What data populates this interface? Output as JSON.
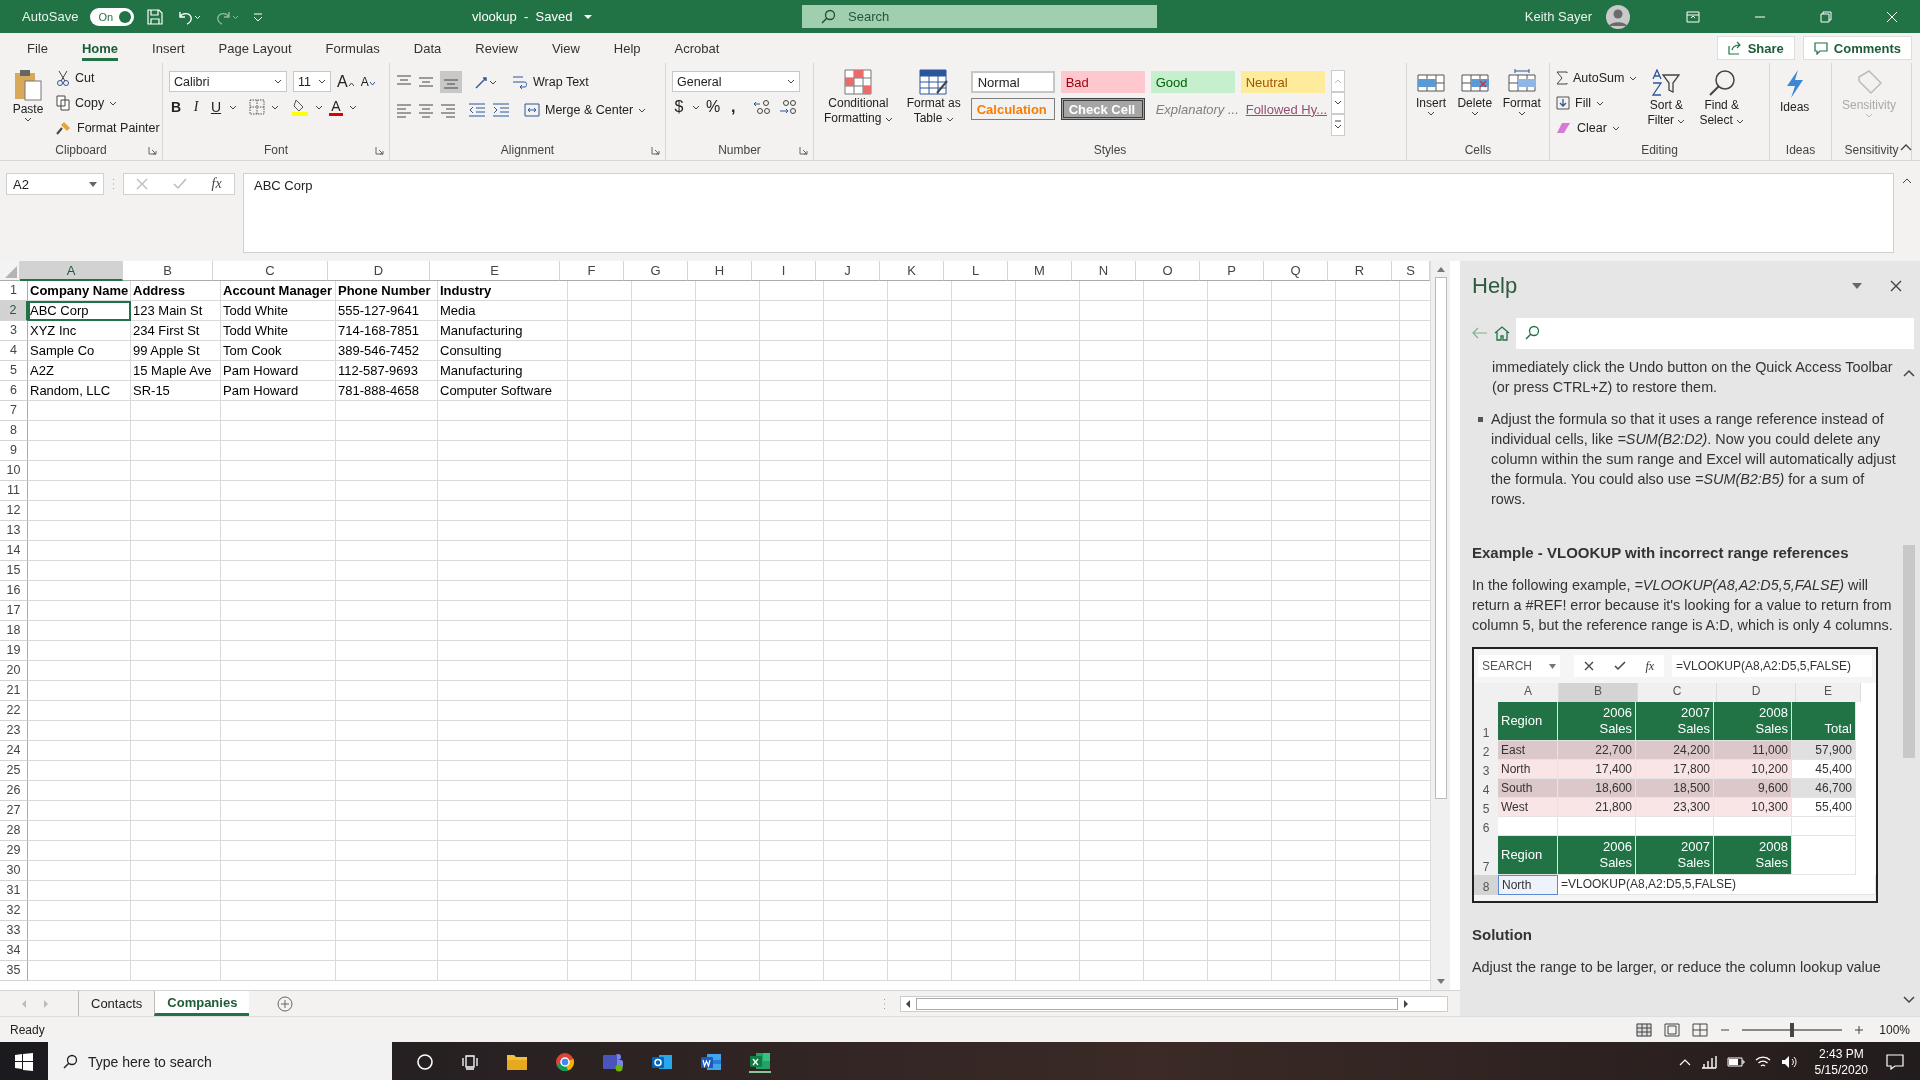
{
  "title_bar": {
    "autosave_label": "AutoSave",
    "autosave": {
      "on": true,
      "label": "On"
    },
    "title": "vlookup  -  Saved",
    "search_placeholder": "Search",
    "user": "Keith Sayer"
  },
  "ribbon_tabs": [
    {
      "label": "File",
      "selected": false
    },
    {
      "label": "Home",
      "selected": true
    },
    {
      "label": "Insert",
      "selected": false
    },
    {
      "label": "Page Layout",
      "selected": false
    },
    {
      "label": "Formulas",
      "selected": false
    },
    {
      "label": "Data",
      "selected": false
    },
    {
      "label": "Review",
      "selected": false
    },
    {
      "label": "View",
      "selected": false
    },
    {
      "label": "Help",
      "selected": false
    },
    {
      "label": "Acrobat",
      "selected": false
    }
  ],
  "share": "Share",
  "comments": "Comments",
  "clipboard": {
    "paste": "Paste",
    "cut": "Cut",
    "copy": "Copy",
    "format_painter": "Format Painter",
    "label": "Clipboard"
  },
  "font": {
    "name": "Calibri",
    "size": "11",
    "grow": "A",
    "shrink": "A",
    "bold": "B",
    "italic": "I",
    "underline": "U",
    "font_color_button": "A",
    "label": "Font"
  },
  "alignment": {
    "wrap_text": "Wrap Text",
    "merge_center": "Merge & Center",
    "label": "Alignment"
  },
  "number": {
    "format": "General",
    "currency": "$",
    "percent": "%",
    "comma": ",",
    "label": "Number"
  },
  "styles": {
    "conditional_formatting": [
      "Conditional",
      "Formatting"
    ],
    "format_as_table": [
      "Format as",
      "Table"
    ],
    "items": [
      {
        "label": "Normal",
        "kind": "normal"
      },
      {
        "label": "Bad",
        "kind": "bad"
      },
      {
        "label": "Good",
        "kind": "good"
      },
      {
        "label": "Neutral",
        "kind": "neutral"
      },
      {
        "label": "Calculation",
        "kind": "calculation"
      },
      {
        "label": "Check Cell",
        "kind": "check"
      },
      {
        "label": "Explanatory ...",
        "kind": "explanatory"
      },
      {
        "label": "Followed Hy...",
        "kind": "hyperlink"
      }
    ],
    "label": "Styles"
  },
  "cells": {
    "buttons": [
      "Insert",
      "Delete",
      "Format"
    ],
    "label": "Cells"
  },
  "editing": {
    "autosum": "AutoSum",
    "fill": "Fill",
    "clear": "Clear",
    "sort_filter": [
      "Sort &",
      "Filter"
    ],
    "find_select": [
      "Find &",
      "Select"
    ],
    "label": "Editing"
  },
  "ideas": {
    "button": "Ideas",
    "label": "Ideas"
  },
  "sensitivity": {
    "button": "Sensitivity",
    "disabled": true,
    "label": "Sensitivity"
  },
  "formula_bar": {
    "name_box": "A2",
    "fx": "fx",
    "formula": "ABC Corp"
  },
  "sheet": {
    "columns": [
      {
        "label": "A",
        "selected": true
      },
      {
        "label": "B",
        "selected": false
      },
      {
        "label": "C",
        "selected": false
      },
      {
        "label": "D",
        "selected": false
      },
      {
        "label": "E",
        "selected": false
      },
      {
        "label": "F",
        "selected": false
      },
      {
        "label": "G",
        "selected": false
      },
      {
        "label": "H",
        "selected": false
      },
      {
        "label": "I",
        "selected": false
      },
      {
        "label": "J",
        "selected": false
      },
      {
        "label": "K",
        "selected": false
      },
      {
        "label": "L",
        "selected": false
      },
      {
        "label": "M",
        "selected": false
      },
      {
        "label": "N",
        "selected": false
      },
      {
        "label": "O",
        "selected": false
      },
      {
        "label": "P",
        "selected": false
      },
      {
        "label": "Q",
        "selected": false
      },
      {
        "label": "R",
        "selected": false
      },
      {
        "label": "S",
        "selected": false
      }
    ],
    "rows": [
      {
        "number": "1",
        "selected": false,
        "bold": true,
        "cells": [
          "Company Name",
          "Address",
          "Account Manager",
          "Phone Number",
          "Industry"
        ]
      },
      {
        "number": "2",
        "selected": true,
        "bold": false,
        "cells": [
          "ABC Corp",
          "123 Main St",
          "Todd White",
          "555-127-9641",
          "Media"
        ]
      },
      {
        "number": "3",
        "selected": false,
        "bold": false,
        "cells": [
          "XYZ Inc",
          "234 First St",
          "Todd White",
          "714-168-7851",
          "Manufacturing"
        ]
      },
      {
        "number": "4",
        "selected": false,
        "bold": false,
        "cells": [
          "Sample Co",
          "99 Apple St",
          "Tom Cook",
          "389-546-7452",
          "Consulting"
        ]
      },
      {
        "number": "5",
        "selected": false,
        "bold": false,
        "cells": [
          "A2Z",
          "15 Maple Ave",
          "Pam Howard",
          "112-587-9693",
          "Manufacturing"
        ]
      },
      {
        "number": "6",
        "selected": false,
        "bold": false,
        "cells": [
          "Random, LLC",
          "SR-15",
          "Pam Howard",
          "781-888-4658",
          "Computer Software"
        ]
      },
      {
        "number": "7",
        "selected": false
      },
      {
        "number": "8",
        "selected": false
      },
      {
        "number": "9",
        "selected": false
      },
      {
        "number": "10",
        "selected": false
      },
      {
        "number": "11",
        "selected": false
      },
      {
        "number": "12",
        "selected": false
      },
      {
        "number": "13",
        "selected": false
      },
      {
        "number": "14",
        "selected": false
      },
      {
        "number": "15",
        "selected": false
      },
      {
        "number": "16",
        "selected": false
      },
      {
        "number": "17",
        "selected": false
      },
      {
        "number": "18",
        "selected": false
      },
      {
        "number": "19",
        "selected": false
      },
      {
        "number": "20",
        "selected": false
      },
      {
        "number": "21",
        "selected": false
      },
      {
        "number": "22",
        "selected": false
      },
      {
        "number": "23",
        "selected": false
      },
      {
        "number": "24",
        "selected": false
      },
      {
        "number": "25",
        "selected": false
      },
      {
        "number": "26",
        "selected": false
      },
      {
        "number": "27",
        "selected": false
      },
      {
        "number": "28",
        "selected": false
      },
      {
        "number": "29",
        "selected": false
      },
      {
        "number": "30",
        "selected": false
      },
      {
        "number": "31",
        "selected": false
      },
      {
        "number": "32",
        "selected": false
      },
      {
        "number": "33",
        "selected": false
      },
      {
        "number": "34",
        "selected": false
      },
      {
        "number": "35",
        "selected": false
      }
    ]
  },
  "sheet_tabs": [
    {
      "label": "Contacts",
      "selected": false
    },
    {
      "label": "Companies",
      "selected": true
    }
  ],
  "help": {
    "title": "Help",
    "blocks": [
      {
        "kind": "text",
        "text": "immediately click the Undo button on the Quick Access Toolbar (or press CTRL+Z) to restore them."
      },
      {
        "kind": "bullet",
        "text": "Adjust the formula so that it uses a range reference instead of individual cells, like *=SUM(B2:D2)*. Now you could delete any column within the sum range and Excel will automatically adjust the formula. You could also use *=SUM(B2:B5)* for a sum of rows."
      },
      {
        "kind": "heading",
        "text": "Example - VLOOKUP with incorrect range references"
      },
      {
        "kind": "paragraph",
        "text": "In the following example, *=VLOOKUP(A8,A2:D5,5,FALSE)* will return a #REF! error because it's looking for a value to return from column 5, but the reference range is A:D, which is only 4 columns."
      },
      {
        "kind": "example",
        "name_box": "SEARCH",
        "fx": "fx",
        "formula": "=VLOOKUP(A8,A2:D5,5,FALSE)",
        "columns": [
          {
            "label": "A",
            "selected": false
          },
          {
            "label": "B",
            "selected": true
          },
          {
            "label": "C",
            "selected": false
          },
          {
            "label": "D",
            "selected": false
          },
          {
            "label": "E",
            "selected": false
          }
        ],
        "rows": [
          {
            "number": "1",
            "kind": "header",
            "selected": false,
            "cells": [
              "Region",
              "2006 Sales",
              "2007 Sales",
              "2008 Sales",
              "Total"
            ]
          },
          {
            "number": "2",
            "kind": "data",
            "selected": false,
            "cells": [
              "East",
              "22,700",
              "24,200",
              "11,000",
              "57,900"
            ]
          },
          {
            "number": "3",
            "kind": "data",
            "selected": false,
            "cells": [
              "North",
              "17,400",
              "17,800",
              "10,200",
              "45,400"
            ]
          },
          {
            "number": "4",
            "kind": "data",
            "selected": false,
            "cells": [
              "South",
              "18,600",
              "18,500",
              "9,600",
              "46,700"
            ]
          },
          {
            "number": "5",
            "kind": "data",
            "selected": false,
            "cells": [
              "West",
              "21,800",
              "23,300",
              "10,300",
              "55,400"
            ]
          },
          {
            "number": "6",
            "kind": "empty",
            "selected": false
          },
          {
            "number": "7",
            "kind": "header",
            "selected": false,
            "cells": [
              "Region",
              "2006 Sales",
              "2007 Sales",
              "2008 Sales"
            ]
          },
          {
            "number": "8",
            "kind": "input",
            "selected": true,
            "cells": [
              "North",
              "=VLOOKUP(A8,A2:D5,5,FALSE)"
            ]
          }
        ]
      },
      {
        "kind": "heading",
        "text": "Solution"
      },
      {
        "kind": "paragraph",
        "text": "Adjust the range to be larger, or reduce the column lookup value"
      }
    ]
  },
  "status_bar": {
    "status": "Ready",
    "zoom": {
      "level": 0.5,
      "reading": "100%"
    }
  },
  "taskbar": {
    "search_placeholder": "Type here to search",
    "time": "2:43 PM",
    "date": "5/15/2020"
  }
}
